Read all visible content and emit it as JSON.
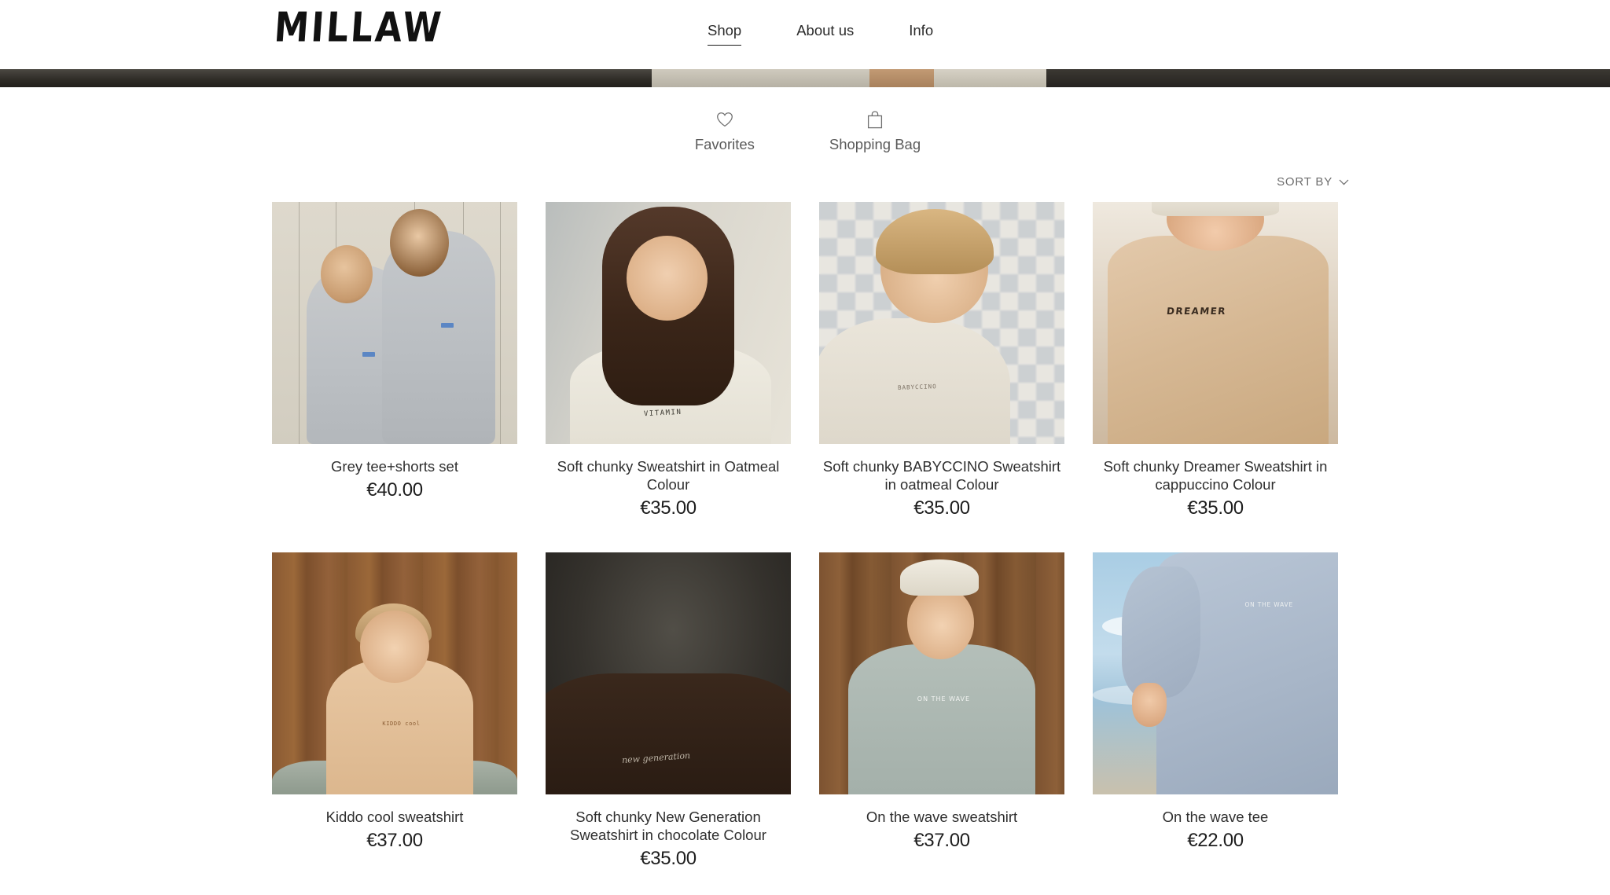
{
  "header": {
    "logo": "MILLAW",
    "nav": [
      {
        "label": "Shop",
        "active": true
      },
      {
        "label": "About us",
        "active": false
      },
      {
        "label": "Info",
        "active": false
      }
    ]
  },
  "utility": {
    "favorites": {
      "label": "Favorites",
      "icon": "heart-icon"
    },
    "shopping_bag": {
      "label": "Shopping Bag",
      "icon": "shopping-bag-icon"
    }
  },
  "toolbar": {
    "sort_by_label": "SORT BY",
    "sort_by_icon": "chevron-down-icon"
  },
  "products": [
    {
      "title": "Grey tee+shorts set",
      "price": "€40.00",
      "image_alt": "two-children-grey-set",
      "print": ""
    },
    {
      "title": "Soft chunky Sweatshirt in Oatmeal Colour",
      "price": "€35.00",
      "image_alt": "girl-oatmeal-vitamin-sweatshirt",
      "print": "VITAMIN"
    },
    {
      "title": "Soft chunky BABYCCINO Sweatshirt in oatmeal Colour",
      "price": "€35.00",
      "image_alt": "boy-babyccino-sweatshirt-tile-floor",
      "print": "BABYCCINO"
    },
    {
      "title": "Soft chunky Dreamer Sweatshirt in cappuccino Colour",
      "price": "€35.00",
      "image_alt": "child-dreamer-cappuccino-sweatshirt-beach",
      "print": "DREAMER"
    },
    {
      "title": "Kiddo cool sweatshirt",
      "price": "€37.00",
      "image_alt": "boy-kiddo-cool-beige-sweatshirt-wood-wall",
      "print": "KIDDO cool"
    },
    {
      "title": "Soft chunky New Generation Sweatshirt in chocolate Colour",
      "price": "€35.00",
      "image_alt": "boy-new-generation-chocolate-sweatshirt",
      "print": "new generation"
    },
    {
      "title": "On the wave sweatshirt",
      "price": "€37.00",
      "image_alt": "boy-on-the-wave-sage-sweatshirt-wood-wall",
      "print": "ON THE WAVE"
    },
    {
      "title": "On the wave tee",
      "price": "€22.00",
      "image_alt": "on-the-wave-blue-tee-beach",
      "print": "ON THE WAVE"
    }
  ],
  "colors": {
    "page_background": "#ffffff",
    "text_primary": "#2f2f2f",
    "text_muted": "#6d6d6d",
    "nav_active_underline": "#1a1a1a"
  }
}
